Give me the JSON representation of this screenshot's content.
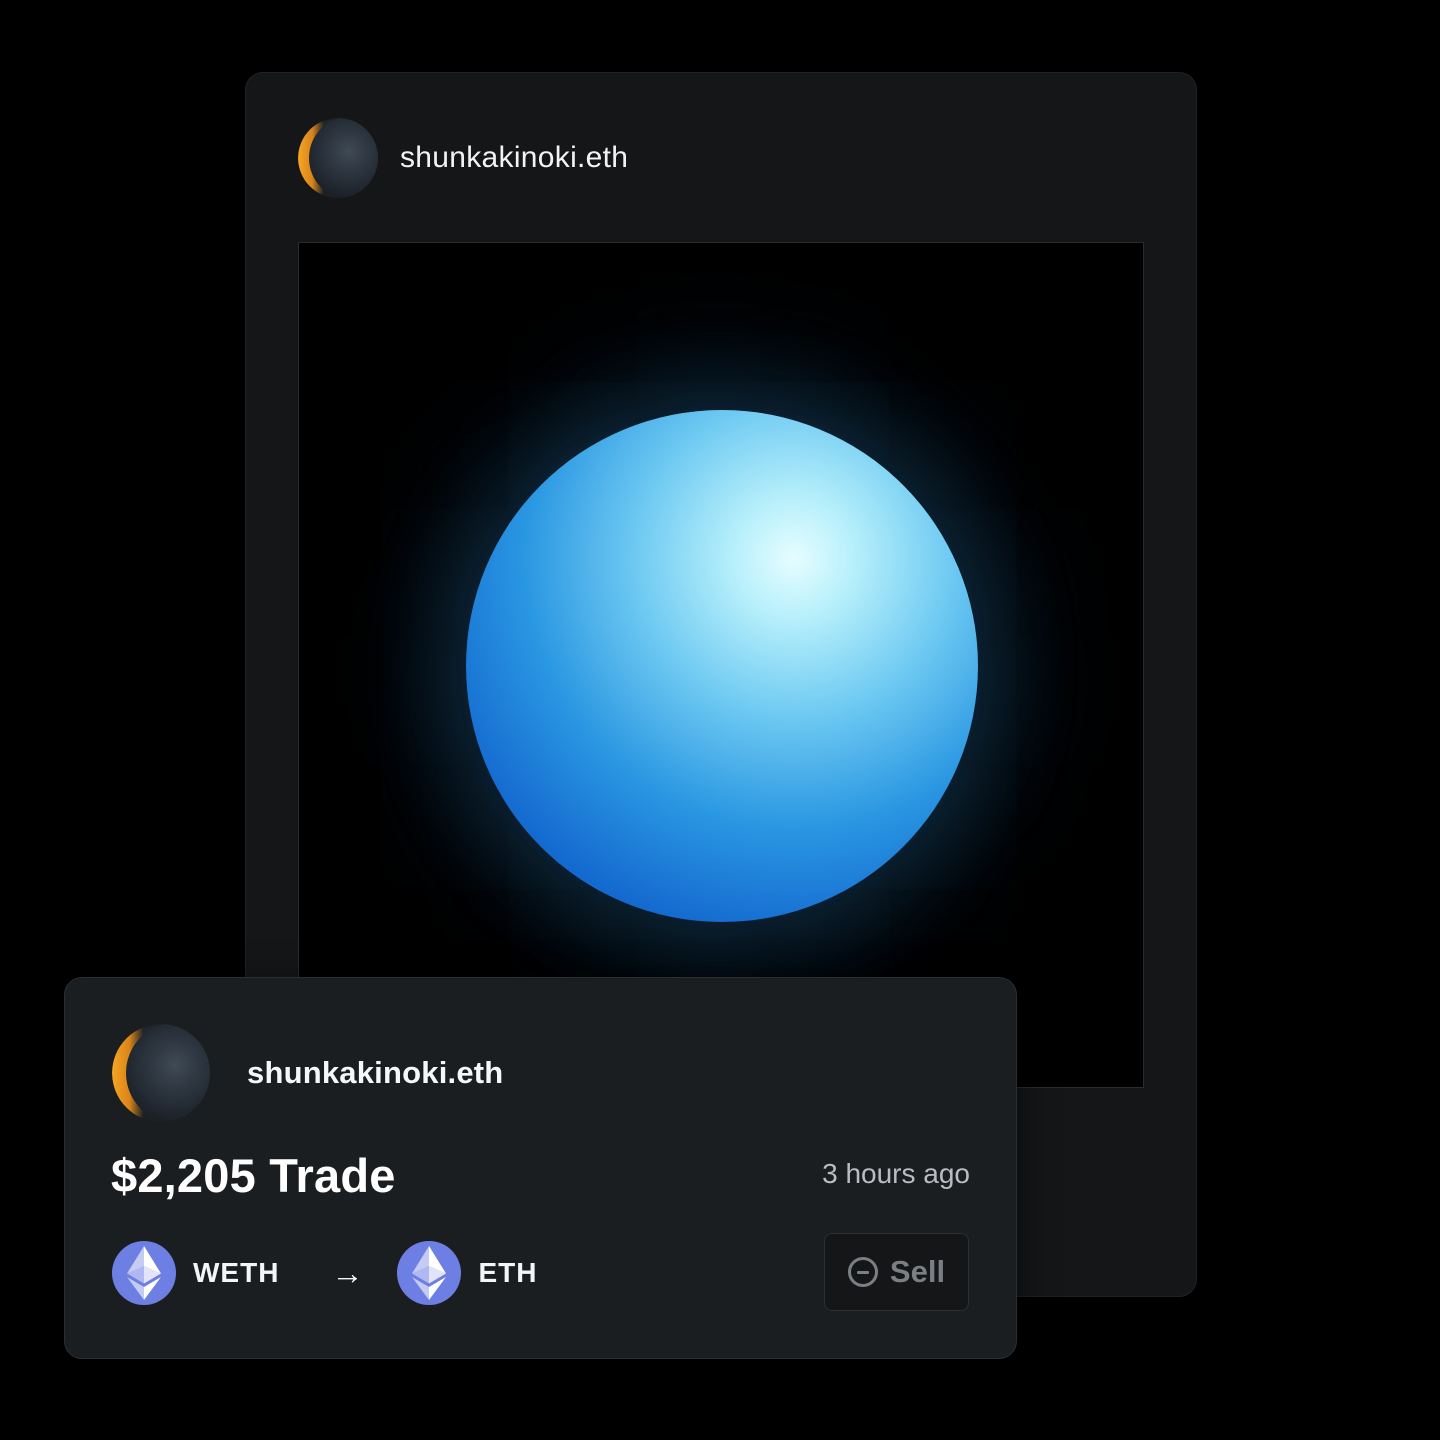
{
  "post": {
    "username": "shunkakinoki.eth",
    "avatar_icon": "crescent-moon-avatar",
    "artwork": "blue-orb-artwork"
  },
  "trade": {
    "username": "shunkakinoki.eth",
    "avatar_icon": "crescent-moon-avatar",
    "title": "$2,205 Trade",
    "time": "3 hours ago",
    "from_token": {
      "label": "WETH",
      "icon": "ethereum-icon"
    },
    "arrow": "→",
    "to_token": {
      "label": "ETH",
      "icon": "ethereum-icon"
    },
    "action": {
      "label": "Sell",
      "icon": "minus-circle-icon"
    }
  },
  "colors": {
    "background": "#000000",
    "card": "#141618",
    "trade_card": "#1b1e20",
    "eth_badge": "#6e7fe3",
    "avatar_accent": "#f6a623",
    "orb_blue": "#1469cf",
    "orb_highlight": "#b8f0fb"
  }
}
